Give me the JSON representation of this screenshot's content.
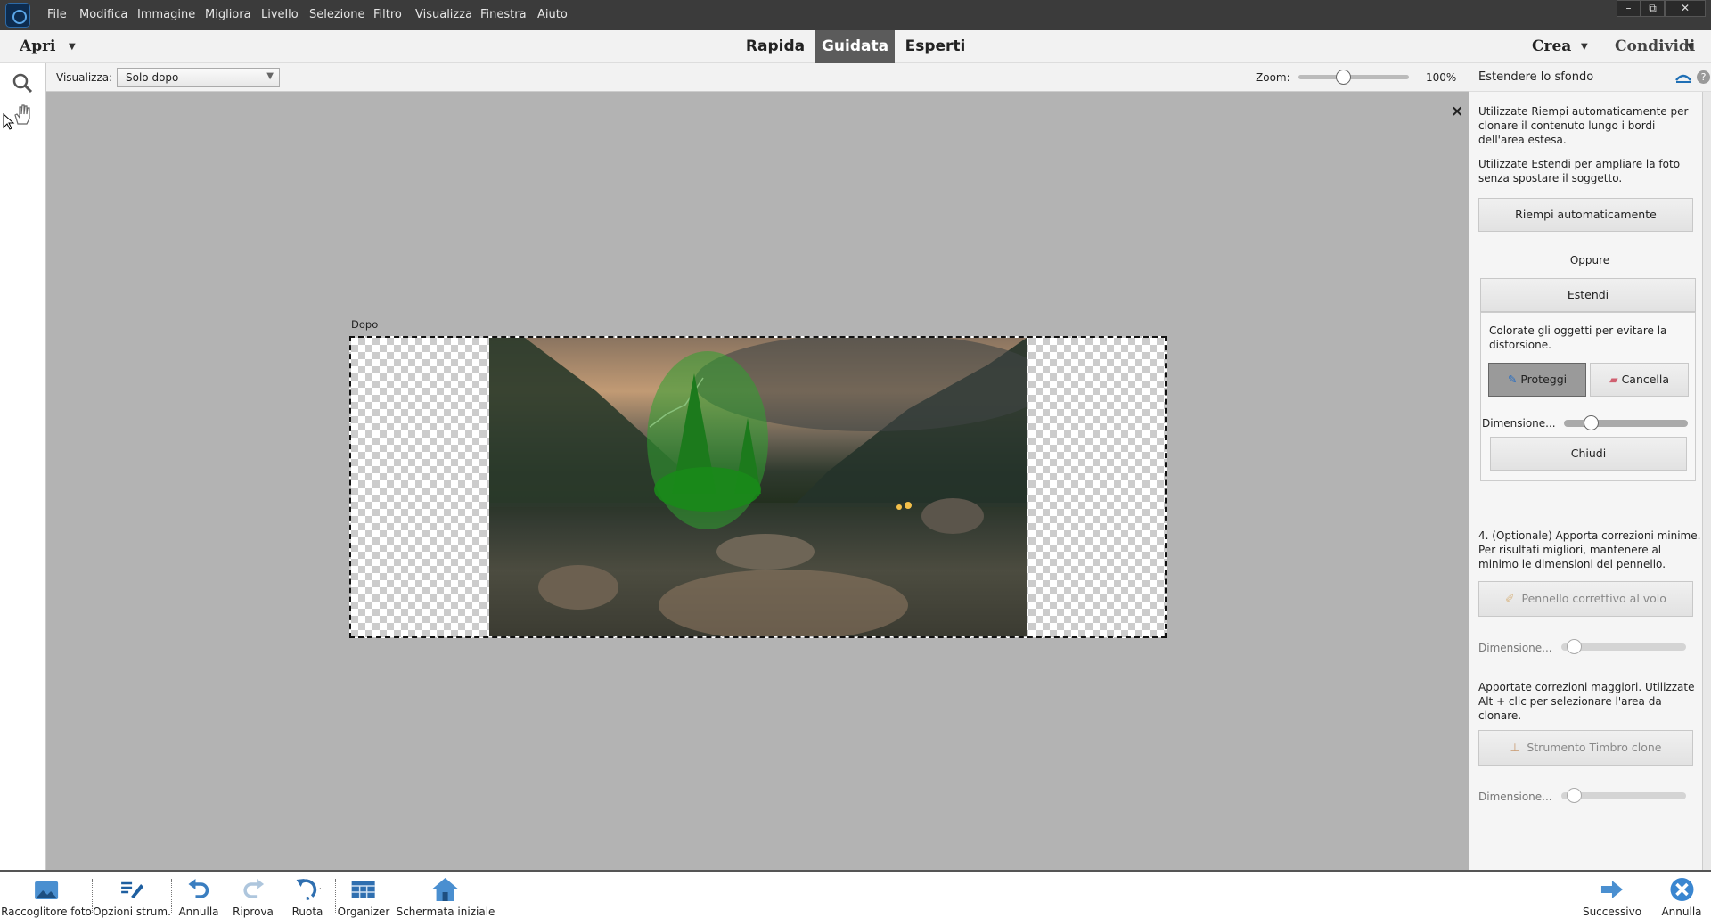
{
  "menu": [
    "File",
    "Modifica",
    "Immagine",
    "Migliora",
    "Livello",
    "Selezione",
    "Filtro",
    "Visualizza",
    "Finestra",
    "Aiuto"
  ],
  "window": {
    "minimize": "–",
    "restore": "⧉",
    "close": "✕"
  },
  "modebar": {
    "open": "Apri",
    "tabs": [
      "Rapida",
      "Guidata",
      "Esperti"
    ],
    "active_tab": "Guidata",
    "create": "Crea",
    "share": "Condividi"
  },
  "options": {
    "view_label": "Visualizza:",
    "view_value": "Solo dopo",
    "zoom_label": "Zoom:",
    "zoom_value": "100%",
    "zoom_fraction": 0.4
  },
  "canvas": {
    "view_caption": "Dopo",
    "close": "×"
  },
  "panel": {
    "title": "Estendere lo sfondo",
    "intro1": "Utilizzate Riempi automaticamente per clonare il contenuto lungo i bordi dell'area estesa.",
    "intro2": "Utilizzate Estendi per ampliare la foto senza spostare il soggetto.",
    "autofill": "Riempi automaticamente",
    "or": "Oppure",
    "extend": "Estendi",
    "paint_hint": "Colorate gli oggetti per evitare la distorsione.",
    "protect": "Proteggi",
    "erase": "Cancella",
    "size": "Dimensione...",
    "close": "Chiudi",
    "step4": "4. (Optionale) Apporta correzioni minime. Per risultati migliori, mantenere al minimo le dimensioni del pennello.",
    "spot_heal": "Pennello correttivo al volo",
    "size2": "Dimensione...",
    "clone_hint": "Apportate correzioni maggiori. Utilizzate Alt + clic per selezionare l'area da clonare.",
    "clone": "Strumento Timbro clone",
    "size3": "Dimensione..."
  },
  "bottom": {
    "photo_bin": "Raccoglitore foto",
    "tool_options": "Opzioni strum.",
    "undo": "Annulla",
    "redo": "Riprova",
    "rotate": "Ruota",
    "organizer": "Organizer",
    "home": "Schermata iniziale",
    "next": "Successivo",
    "cancel": "Annulla"
  }
}
